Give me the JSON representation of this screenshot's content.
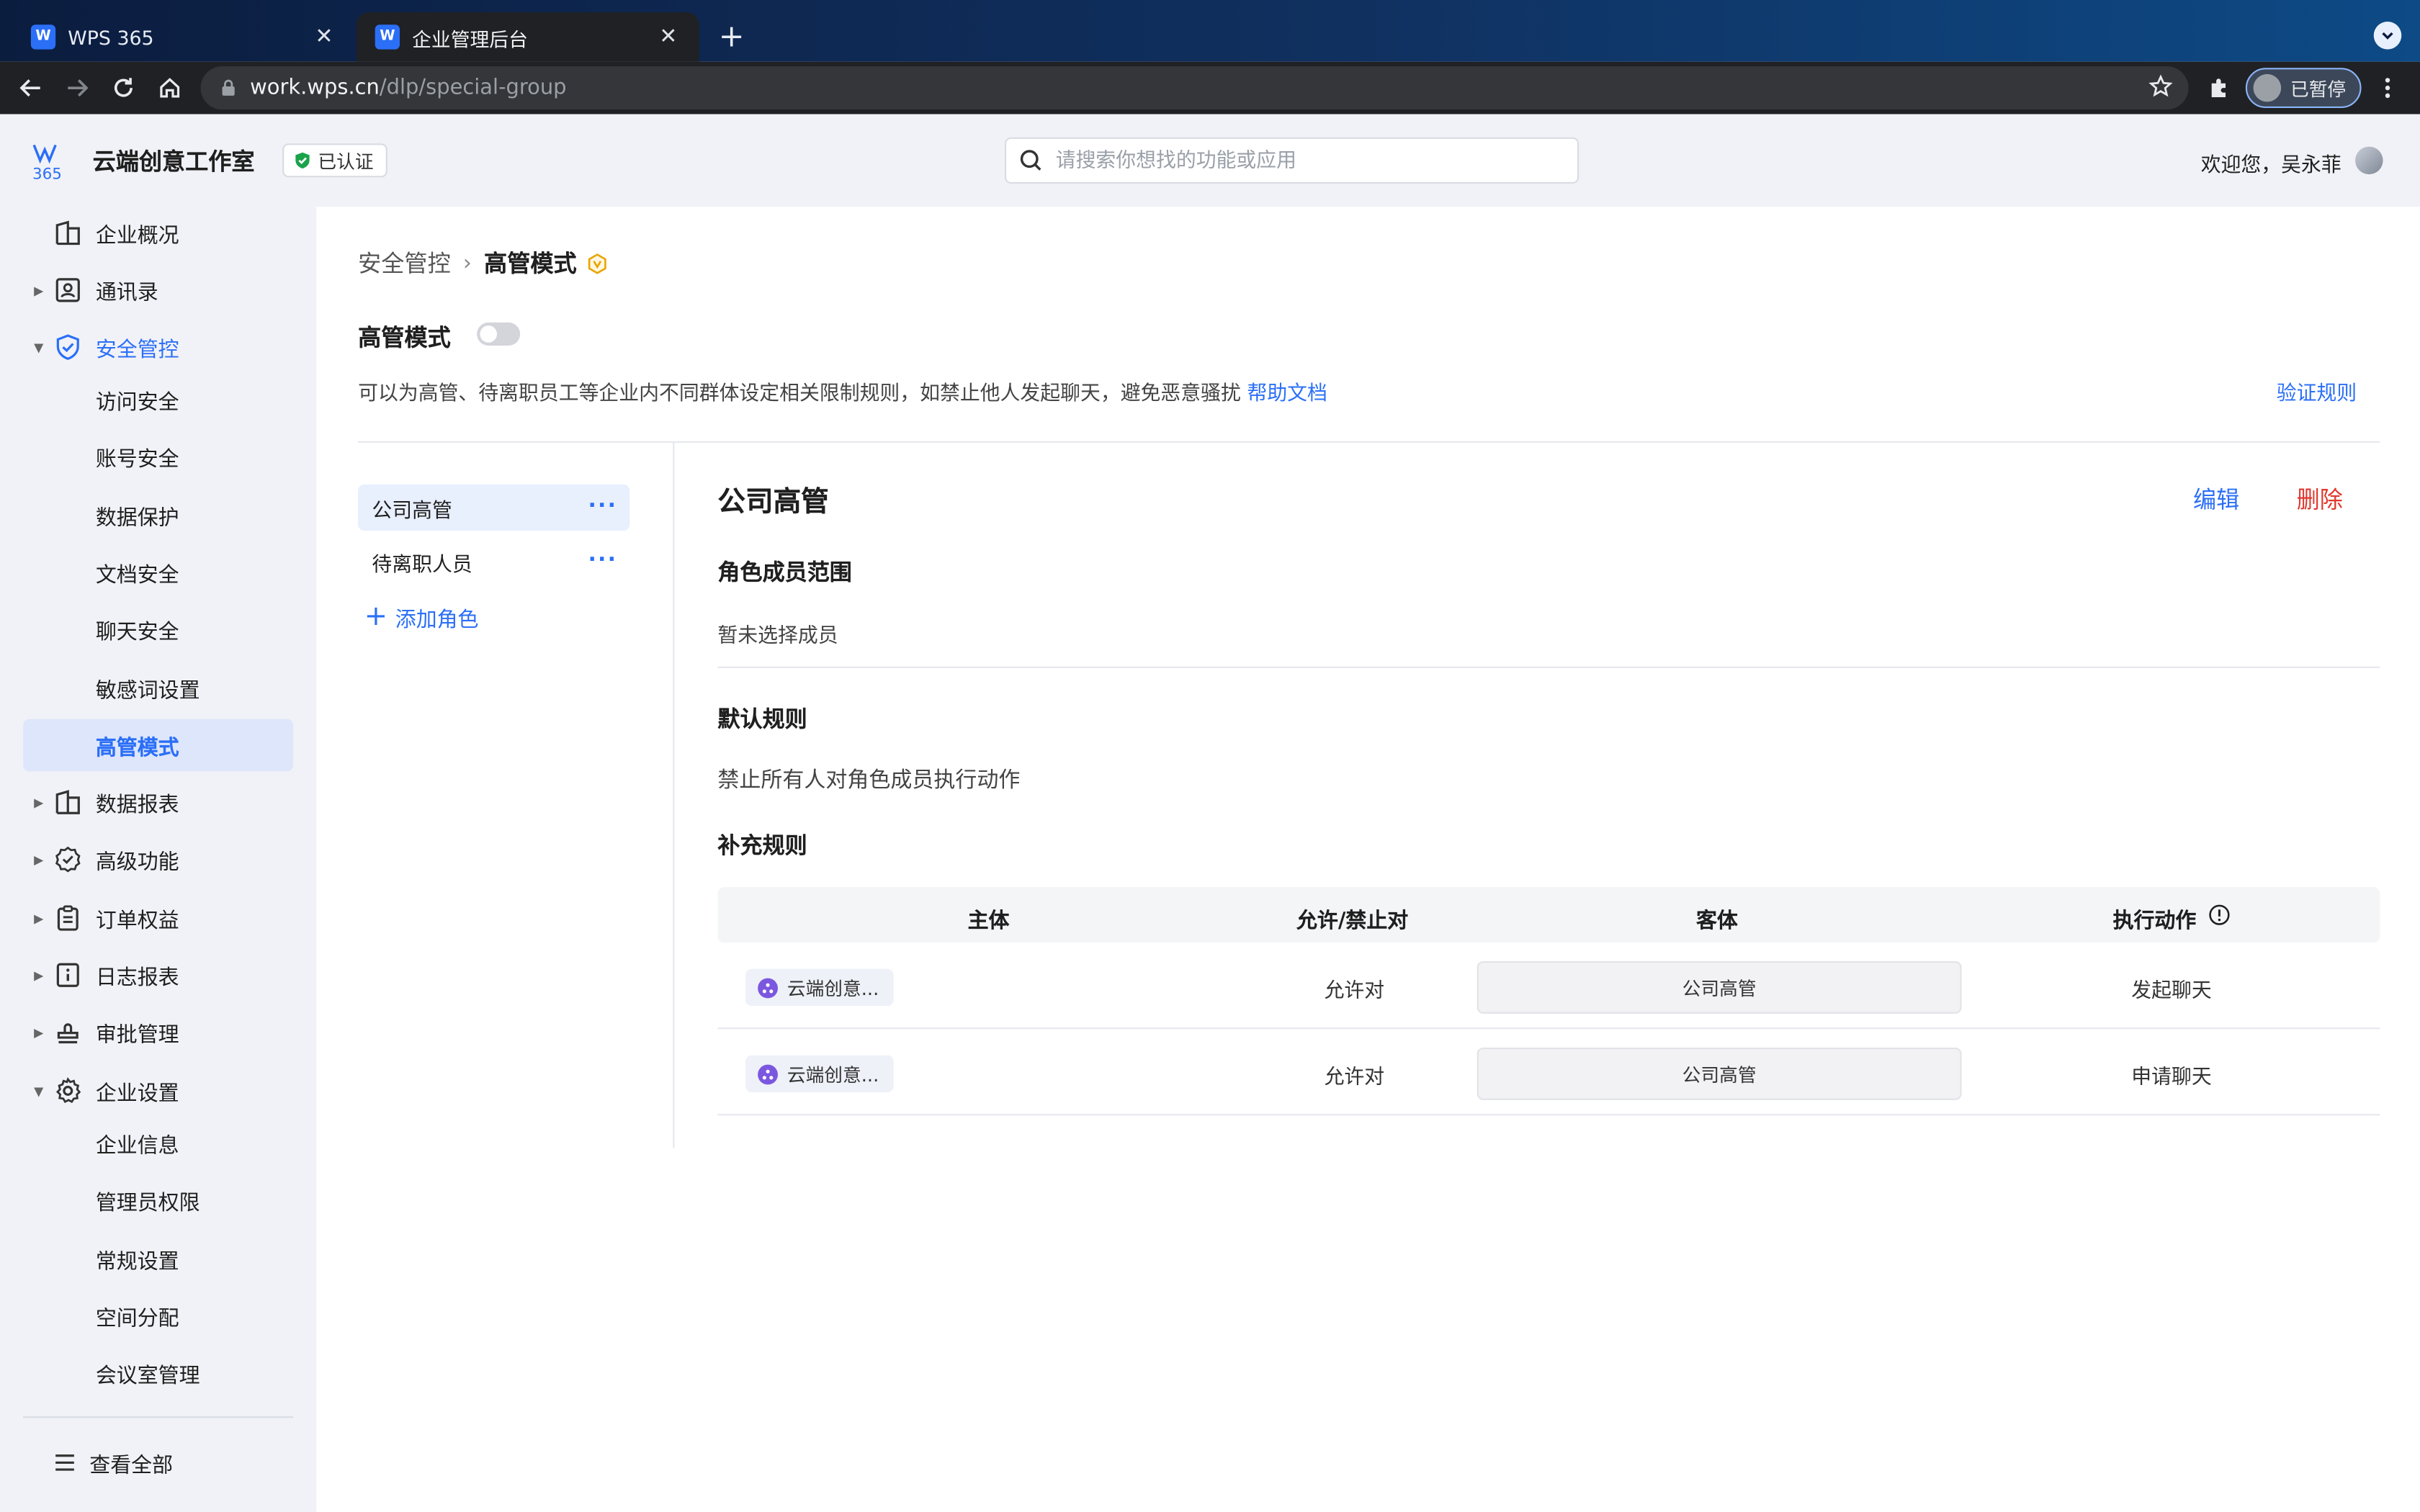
{
  "browser": {
    "tabs": [
      {
        "title": "WPS 365",
        "favicon": "W",
        "active": false
      },
      {
        "title": "企业管理后台",
        "favicon": "W",
        "active": true
      }
    ],
    "url_host": "work.wps.cn",
    "url_path": "/dlp/special-group",
    "profile_label": "已暂停"
  },
  "header": {
    "org_name": "云端创意工作室",
    "verified_label": "已认证",
    "search_placeholder": "请搜索你想找的功能或应用",
    "welcome": "欢迎您，吴永菲"
  },
  "sidebar": {
    "items": [
      {
        "label": "企业概况",
        "icon": "building-icon"
      },
      {
        "label": "通讯录",
        "icon": "contacts-icon"
      },
      {
        "label": "安全管控",
        "icon": "shield-icon"
      },
      {
        "label": "访问安全"
      },
      {
        "label": "账号安全"
      },
      {
        "label": "数据保护"
      },
      {
        "label": "文档安全"
      },
      {
        "label": "聊天安全"
      },
      {
        "label": "敏感词设置"
      },
      {
        "label": "高管模式"
      },
      {
        "label": "数据报表",
        "icon": "building-icon"
      },
      {
        "label": "高级功能",
        "icon": "badge-check-icon"
      },
      {
        "label": "订单权益",
        "icon": "clipboard-icon"
      },
      {
        "label": "日志报表",
        "icon": "info-doc-icon"
      },
      {
        "label": "审批管理",
        "icon": "stamp-icon"
      },
      {
        "label": "企业设置",
        "icon": "gear-icon"
      },
      {
        "label": "企业信息"
      },
      {
        "label": "管理员权限"
      },
      {
        "label": "常规设置"
      },
      {
        "label": "空间分配"
      },
      {
        "label": "会议室管理"
      }
    ],
    "view_all": "查看全部"
  },
  "main": {
    "breadcrumb_parent": "安全管控",
    "breadcrumb_current": "高管模式",
    "mode_title": "高管模式",
    "description": "可以为高管、待离职员工等企业内不同群体设定相关限制规则，如禁止他人发起聊天，避免恶意骚扰",
    "help_link": "帮助文档",
    "verify_link": "验证规则",
    "roles": [
      {
        "label": "公司高管",
        "more": "···"
      },
      {
        "label": "待离职人员",
        "more": "···"
      }
    ],
    "add_role": "添加角色",
    "detail": {
      "title": "公司高管",
      "edit": "编辑",
      "delete": "删除",
      "scope_title": "角色成员范围",
      "scope_value": "暂未选择成员",
      "default_title": "默认规则",
      "default_value": "禁止所有人对角色成员执行动作",
      "extra_title": "补充规则",
      "table_headers": {
        "subject": "主体",
        "allow": "允许/禁止对",
        "object": "客体",
        "action": "执行动作"
      },
      "rows": [
        {
          "subject": "云端创意...",
          "allow": "允许对",
          "object": "公司高管",
          "action": "发起聊天"
        },
        {
          "subject": "云端创意...",
          "allow": "允许对",
          "object": "公司高管",
          "action": "申请聊天"
        }
      ]
    }
  },
  "colors": {
    "accent": "#2b6ff7",
    "danger": "#e0362c",
    "selected_bg": "#dde6fb"
  }
}
